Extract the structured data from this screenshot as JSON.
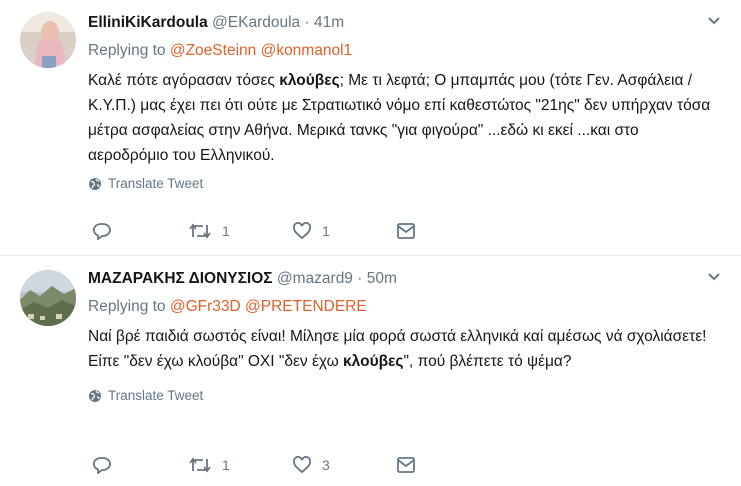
{
  "tweets": [
    {
      "fullname": "ElliniKiKardoula",
      "screenname": "@EKardoula",
      "separator": "·",
      "time": "41m",
      "replying_label": "Replying to",
      "mentions": [
        "@ZoeSteinn",
        "@konmanol1"
      ],
      "text_parts": [
        {
          "t": "Καλέ πότε αγόρασαν τόσες ",
          "b": false
        },
        {
          "t": "κλούβες",
          "b": true
        },
        {
          "t": "; Με τι λεφτά; Ο μπαμπάς μου (τότε Γεν. Ασφάλεια / Κ.Υ.Π.) μας έχει πει ότι ούτε με Στρατιωτικό νόμο επί καθεστώτος \"21ης\" δεν υπήρχαν τόσα μέτρα ασφαλείας στην Αθήνα. Μερικά τανκς \"για φιγούρα\" ...εδώ κι εκεί ...και στο αεροδρόμιο του Ελληνικού.",
          "b": false
        }
      ],
      "translate_label": "Translate Tweet",
      "retweet_count": "1",
      "like_count": "1"
    },
    {
      "fullname": "ΜΑΖΑΡΑΚΗΣ ΔΙΟΝΥΣΙΟΣ",
      "screenname": "@mazard9",
      "separator": "·",
      "time": "50m",
      "replying_label": "Replying to",
      "mentions": [
        "@GFr33D",
        "@PRETENDERE"
      ],
      "text_parts": [
        {
          "t": "Ναί βρέ παιδιά σωστός είναι! Μίλησε μία φορά σωστά ελληνικά καί αμέσως νά σχολιάσετε! Είπε \"δεν  έχω κλούβα\" ΟΧΙ \"δεν έχω ",
          "b": false
        },
        {
          "t": "κλούβες",
          "b": true
        },
        {
          "t": "\", πού βλέπετε τό ψέμα?",
          "b": false
        }
      ],
      "translate_label": "Translate Tweet",
      "retweet_count": "1",
      "like_count": "3"
    }
  ],
  "colors": {
    "mention": "#e0612b",
    "secondary_text": "#657786",
    "primary_text": "#14171a",
    "divider": "#e6ecf0"
  },
  "icons": [
    "chevron-down-icon",
    "globe-icon",
    "reply-icon",
    "retweet-icon",
    "like-icon",
    "direct-message-icon"
  ]
}
